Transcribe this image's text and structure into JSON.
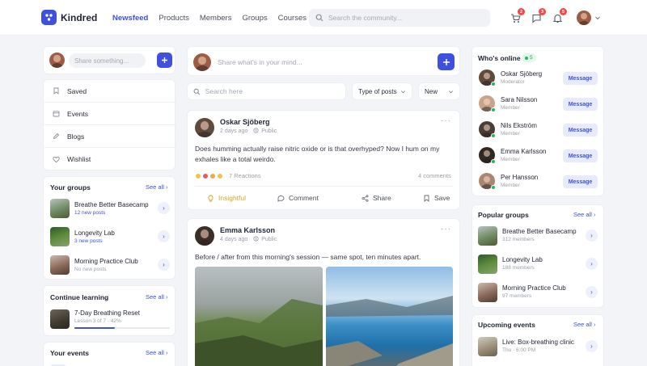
{
  "header": {
    "brand": "Kindred",
    "nav": [
      "Newsfeed",
      "Products",
      "Members",
      "Groups",
      "Courses"
    ],
    "search_placeholder": "Search the community...",
    "cart_badge": "2",
    "messages_badge": "3",
    "notifications_badge": "5",
    "accent": "#3d50e0"
  },
  "left": {
    "share_placeholder": "Share something...",
    "menu": [
      "Saved",
      "Events",
      "Blogs",
      "Wishlist"
    ],
    "groups": {
      "title": "Your groups",
      "see_all": "See all",
      "items": [
        {
          "name": "Breathe Better Basecamp",
          "sub": "12 new posts"
        },
        {
          "name": "Longevity Lab",
          "sub": "3 new posts"
        },
        {
          "name": "Morning Practice Club",
          "sub": "No new posts"
        }
      ]
    },
    "learning": {
      "title": "Continue learning",
      "see_all": "See all",
      "course": "7-Day Breathing Reset",
      "progress_text": "Lesson 3 of 7 · 42%",
      "progress": 0.42
    },
    "events": {
      "title": "Your events",
      "see_all": "See all"
    }
  },
  "feed": {
    "composer_placeholder": "Share what's in your mind...",
    "search_placeholder": "Search here",
    "type_filter": "Type of posts",
    "sort": "New",
    "posts": [
      {
        "author": "Oskar Sjöberg",
        "time": "2 days ago",
        "visibility": "Public",
        "text_lines": [
          "Does humming actually raise nitric oxide or is that overhyped? Now I hum on my",
          "exhales like a total weirdo."
        ],
        "reactions": "7 Reactions",
        "comments": "4 comments",
        "actions": [
          "Insightful",
          "Comment",
          "Share",
          "Save"
        ]
      },
      {
        "author": "Emma Karlsson",
        "time": "4 days ago",
        "visibility": "Public",
        "text": "Before / after from this morning's session — same spot, ten minutes apart."
      }
    ]
  },
  "right": {
    "online": {
      "title": "Who's online",
      "count": "5",
      "message_label": "Message",
      "people": [
        {
          "name": "Oskar Sjöberg",
          "role": "Moderator"
        },
        {
          "name": "Sara Nilsson",
          "role": "Member"
        },
        {
          "name": "Nils Ekström",
          "role": "Member"
        },
        {
          "name": "Emma Karlsson",
          "role": "Member"
        },
        {
          "name": "Per Hansson",
          "role": "Member"
        }
      ]
    },
    "popular": {
      "title": "Popular groups",
      "see_all": "See all",
      "items": [
        {
          "name": "Breathe Better Basecamp",
          "sub": "312 members"
        },
        {
          "name": "Longevity Lab",
          "sub": "188 members"
        },
        {
          "name": "Morning Practice Club",
          "sub": "97 members"
        }
      ]
    },
    "upcoming": {
      "title": "Upcoming events",
      "see_all": "See all",
      "items": [
        {
          "name": "Live: Box-breathing clinic",
          "sub": "Thu · 6:00 PM"
        }
      ]
    }
  }
}
